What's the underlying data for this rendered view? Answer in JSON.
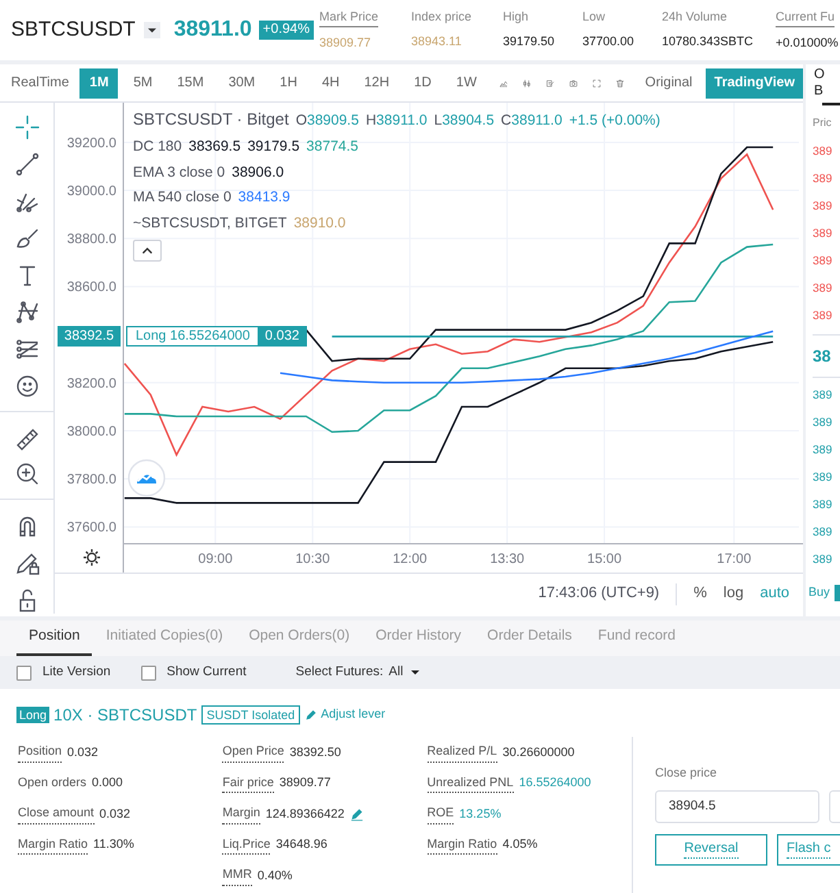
{
  "header": {
    "symbol": "SBTCSUSDT",
    "last_price": "38911.0",
    "change": "+0.94%",
    "stats": [
      {
        "label": "Mark Price",
        "value": "38909.77",
        "color": "#c8a56e",
        "underlined": true
      },
      {
        "label": "Index price",
        "value": "38943.11",
        "color": "#c8a56e",
        "underlined": false
      },
      {
        "label": "High",
        "value": "39179.50",
        "color": "#222222",
        "underlined": false
      },
      {
        "label": "Low",
        "value": "37700.00",
        "color": "#222222",
        "underlined": false
      },
      {
        "label": "24h Volume",
        "value": "10780.343SBTC",
        "color": "#222222",
        "underlined": false
      },
      {
        "label": "Current Fu",
        "value": "+0.01000%",
        "color": "#222222",
        "underlined": true
      }
    ]
  },
  "toolbar": {
    "mode": "RealTime",
    "intervals": [
      {
        "label": "1M",
        "selected": true
      },
      {
        "label": "5M",
        "selected": false
      },
      {
        "label": "15M",
        "selected": false
      },
      {
        "label": "30M",
        "selected": false
      },
      {
        "label": "1H",
        "selected": false
      },
      {
        "label": "4H",
        "selected": false
      },
      {
        "label": "12H",
        "selected": false
      },
      {
        "label": "1D",
        "selected": false
      },
      {
        "label": "1W",
        "selected": false
      }
    ],
    "views": [
      {
        "label": "Original",
        "selected": false
      },
      {
        "label": "TradingView",
        "selected": true
      }
    ]
  },
  "chart": {
    "legend": {
      "title": "SBTCSUSDT · Bitget",
      "ohlc": [
        {
          "key": "O",
          "value": "38909.5"
        },
        {
          "key": "H",
          "value": "38911.0"
        },
        {
          "key": "L",
          "value": "38904.5"
        },
        {
          "key": "C",
          "value": "38911.0"
        }
      ],
      "change": "+1.5 (+0.00%)",
      "indicators": [
        {
          "name": "DC 180",
          "values": [
            {
              "text": "38369.5",
              "color": "#131722"
            },
            {
              "text": "39179.5",
              "color": "#131722"
            },
            {
              "text": "38774.5",
              "color": "#26a69a"
            }
          ]
        },
        {
          "name": "EMA 3 close 0",
          "values": [
            {
              "text": "38906.0",
              "color": "#131722"
            }
          ]
        },
        {
          "name": "MA 540 close 0",
          "values": [
            {
              "text": "38413.9",
              "color": "#2979ff"
            }
          ]
        },
        {
          "name": "~SBTCSUSDT, BITGET",
          "values": [
            {
              "text": "38910.0",
              "color": "#c8a56e"
            }
          ]
        }
      ]
    },
    "position_line": {
      "price_tag": "38392.5",
      "label": "Long 16.55264000",
      "quantity": "0.032"
    },
    "chart_data": {
      "type": "line",
      "x": [
        7.6,
        8.0,
        8.4,
        8.8,
        9.2,
        9.6,
        10.0,
        10.4,
        10.8,
        11.2,
        11.6,
        12.0,
        12.4,
        12.8,
        13.2,
        13.6,
        14.0,
        14.4,
        14.8,
        15.2,
        15.6,
        16.0,
        16.4,
        16.8,
        17.2,
        17.6
      ],
      "series": [
        {
          "color": "#ef5350",
          "values": [
            38280,
            38150,
            37900,
            38100,
            38080,
            38100,
            38050,
            38150,
            38250,
            38300,
            38290,
            38340,
            38360,
            38320,
            38330,
            38380,
            38370,
            38390,
            38410,
            38450,
            38520,
            38700,
            38850,
            39050,
            39150,
            38920
          ]
        },
        {
          "color": "#131722",
          "values": [
            null,
            null,
            null,
            null,
            null,
            null,
            null,
            38420,
            38290,
            38300,
            38300,
            38300,
            38420,
            38420,
            38420,
            38420,
            38420,
            38420,
            38450,
            38500,
            38560,
            38780,
            38780,
            39070,
            39180,
            39180
          ]
        },
        {
          "color": "#131722",
          "values": [
            37720,
            37720,
            37700,
            37700,
            37700,
            37700,
            37700,
            37700,
            37700,
            37700,
            37870,
            37870,
            37870,
            38100,
            38100,
            38150,
            38200,
            38260,
            38260,
            38260,
            38270,
            38290,
            38300,
            38330,
            38350,
            38370
          ]
        },
        {
          "color": "#26a69a",
          "values": [
            38070,
            38070,
            38060,
            38060,
            38060,
            38060,
            38060,
            38060,
            37995,
            38000,
            38085,
            38085,
            38145,
            38260,
            38260,
            38285,
            38310,
            38340,
            38355,
            38380,
            38415,
            38535,
            38540,
            38700,
            38765,
            38775
          ]
        },
        {
          "color": "#1f9fa9",
          "values": [
            null,
            null,
            null,
            null,
            null,
            null,
            null,
            null,
            38392.5,
            38392.5,
            38392.5,
            38392.5,
            38392.5,
            38392.5,
            38392.5,
            38392.5,
            38392.5,
            38392.5,
            38392.5,
            38392.5,
            38392.5,
            38392.5,
            38392.5,
            38392.5,
            38392.5,
            38392.5
          ]
        },
        {
          "color": "#2979ff",
          "values": [
            null,
            null,
            null,
            null,
            null,
            null,
            38240,
            38225,
            38210,
            38205,
            38200,
            38200,
            38200,
            38200,
            38205,
            38210,
            38215,
            38225,
            38240,
            38260,
            38280,
            38300,
            38325,
            38355,
            38385,
            38414
          ]
        }
      ],
      "xlim": [
        7.58,
        18.0
      ],
      "ylim": [
        37530,
        39365
      ],
      "grid": true,
      "xticks": [
        {
          "value": 9,
          "label": "09:00"
        },
        {
          "value": 10.5,
          "label": "10:30"
        },
        {
          "value": 12,
          "label": "12:00"
        },
        {
          "value": 13.5,
          "label": "13:30"
        },
        {
          "value": 15,
          "label": "15:00"
        },
        {
          "value": 17,
          "label": "17:00"
        }
      ],
      "yticks": [
        {
          "value": 37600,
          "label": "37600.0"
        },
        {
          "value": 37800,
          "label": "37800.0"
        },
        {
          "value": 38000,
          "label": "38000.0"
        },
        {
          "value": 38200,
          "label": "38200.0"
        },
        {
          "value": 38600,
          "label": "38600.0"
        },
        {
          "value": 38800,
          "label": "38800.0"
        },
        {
          "value": 39000,
          "label": "39000.0"
        },
        {
          "value": 39200,
          "label": "39200.0"
        }
      ]
    },
    "footer": {
      "time": "17:43:06 (UTC+9)",
      "options": [
        {
          "label": "%",
          "selected": false
        },
        {
          "label": "log",
          "selected": false
        },
        {
          "label": "auto",
          "selected": true
        }
      ]
    }
  },
  "order_book": {
    "tabs": [
      "O",
      "B"
    ],
    "header": "Pric",
    "asks": [
      "389",
      "389",
      "389",
      "389",
      "389",
      "389",
      "389"
    ],
    "last_price": "38",
    "bids": [
      "389",
      "389",
      "389",
      "389",
      "389",
      "389",
      "389"
    ],
    "buy": "Buy"
  },
  "positions_panel": {
    "tabs": [
      {
        "label": "Position",
        "selected": true
      },
      {
        "label": "Initiated Copies(0)",
        "selected": false
      },
      {
        "label": "Open Orders(0)",
        "selected": false
      },
      {
        "label": "Order History",
        "selected": false
      },
      {
        "label": "Order Details",
        "selected": false
      },
      {
        "label": "Fund record",
        "selected": false
      }
    ],
    "filters": [
      {
        "label": "Lite Version",
        "checked": false
      },
      {
        "label": "Show Current",
        "checked": false
      }
    ],
    "select_futures": {
      "label": "Select Futures:",
      "value": "All"
    },
    "position": {
      "side": "Long",
      "title": "10X · SBTCSUSDT",
      "margin_mode": "SUSDT Isolated",
      "adjust": "Adjust lever",
      "columns": [
        [
          {
            "label": "Position",
            "value": "0.032",
            "underlined": true,
            "highlight": false,
            "editable": false
          },
          {
            "label": "Open orders",
            "value": "0.000",
            "underlined": false,
            "highlight": false,
            "editable": false
          },
          {
            "label": "Close amount",
            "value": "0.032",
            "underlined": true,
            "highlight": false,
            "editable": false
          },
          {
            "label": "Margin Ratio",
            "value": "11.30%",
            "underlined": true,
            "highlight": false,
            "editable": false
          }
        ],
        [
          {
            "label": "Open Price",
            "value": "38392.50",
            "underlined": true,
            "highlight": false,
            "editable": false
          },
          {
            "label": "Fair price",
            "value": "38909.77",
            "underlined": true,
            "highlight": false,
            "editable": false
          },
          {
            "label": "Margin",
            "value": "124.89366422",
            "underlined": true,
            "highlight": false,
            "editable": true
          },
          {
            "label": "Liq.Price",
            "value": "34648.96",
            "underlined": true,
            "highlight": false,
            "editable": false
          },
          {
            "label": "MMR",
            "value": "0.40%",
            "underlined": true,
            "highlight": false,
            "editable": false
          }
        ],
        [
          {
            "label": "Realized P/L",
            "value": "30.26600000",
            "underlined": true,
            "highlight": false,
            "editable": false
          },
          {
            "label": "Unrealized PNL",
            "value": "16.55264000",
            "underlined": true,
            "highlight": true,
            "editable": false
          },
          {
            "label": "ROE",
            "value": "13.25%",
            "underlined": true,
            "highlight": true,
            "editable": false
          },
          {
            "label": "Margin Ratio",
            "value": "4.05%",
            "underlined": true,
            "highlight": false,
            "editable": false
          }
        ]
      ]
    },
    "close": {
      "label": "Close price",
      "value": "38904.5",
      "buttons": [
        "Reversal",
        "Flash c"
      ]
    }
  }
}
